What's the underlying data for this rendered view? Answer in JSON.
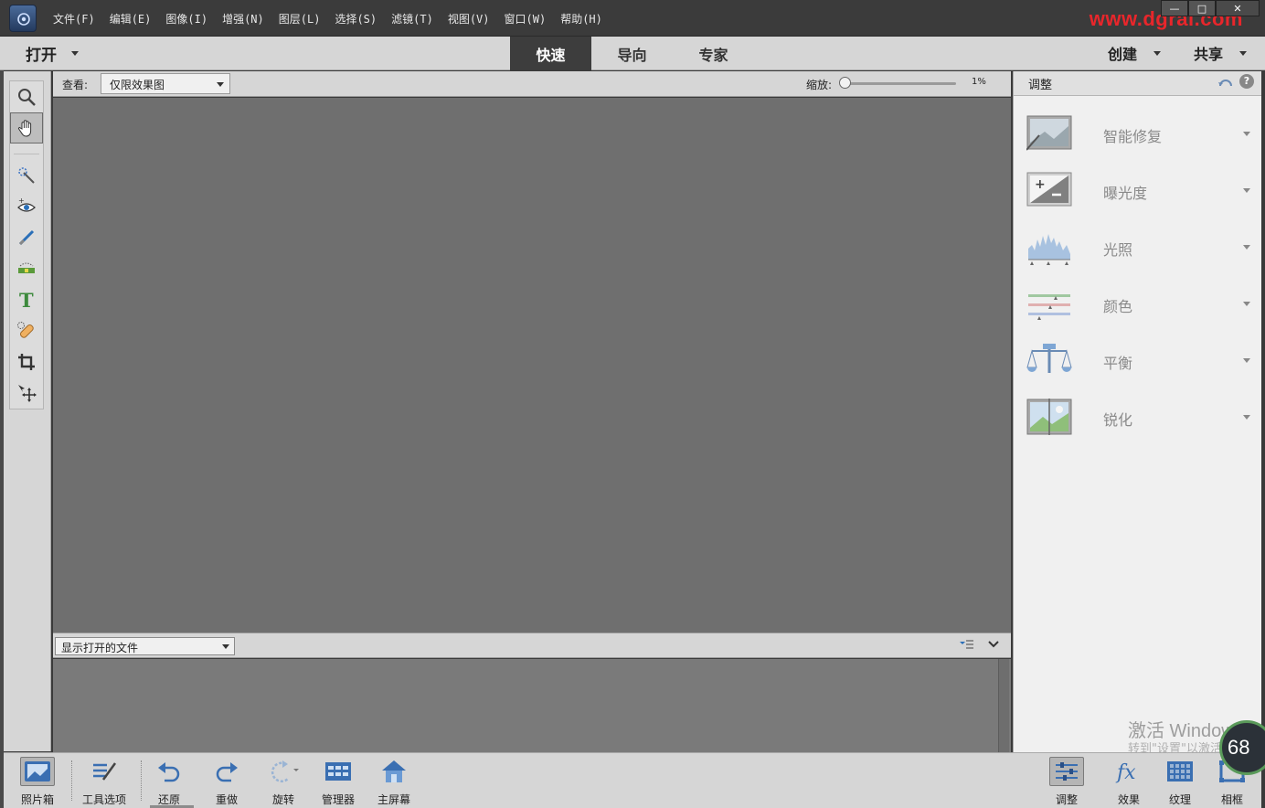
{
  "menu": {
    "items": [
      "文件(F)",
      "编辑(E)",
      "图像(I)",
      "增强(N)",
      "图层(L)",
      "选择(S)",
      "滤镜(T)",
      "视图(V)",
      "窗口(W)",
      "帮助(H)"
    ]
  },
  "window_controls": {
    "minimize": "—",
    "maximize": "□",
    "close": "✕"
  },
  "watermark_url": "www.dgrai.com",
  "modebar": {
    "open_label": "打开",
    "tabs": [
      "快速",
      "导向",
      "专家"
    ],
    "active_tab": "快速",
    "create_label": "创建",
    "share_label": "共享"
  },
  "tools": [
    "zoom-tool",
    "hand-tool",
    "quick-selection-tool",
    "red-eye-tool",
    "whiten-teeth-tool",
    "straighten-tool",
    "text-tool",
    "spot-healing-tool",
    "crop-tool",
    "move-tool"
  ],
  "view_bar": {
    "view_label": "查看:",
    "view_value": "仅限效果图",
    "zoom_label": "缩放:",
    "zoom_value": "1%",
    "zoom_fraction": 0.0
  },
  "bin": {
    "filter_value": "显示打开的文件"
  },
  "adjust_panel": {
    "title": "调整",
    "items": [
      {
        "label": "智能修复",
        "icon": "smart-fix-icon"
      },
      {
        "label": "曝光度",
        "icon": "exposure-icon"
      },
      {
        "label": "光照",
        "icon": "lighting-icon"
      },
      {
        "label": "颜色",
        "icon": "color-icon"
      },
      {
        "label": "平衡",
        "icon": "balance-icon"
      },
      {
        "label": "锐化",
        "icon": "sharpen-icon"
      }
    ]
  },
  "bottombar": {
    "photo_bin": "照片箱",
    "tool_options": "工具选项",
    "undo": "还原",
    "redo": "重做",
    "rotate": "旋转",
    "organizer": "管理器",
    "home_screen": "主屏幕",
    "adjust": "调整",
    "effects": "效果",
    "textures": "纹理",
    "frames": "相框"
  },
  "overlay": {
    "activation_title": "激活 Windows",
    "activation_sub": "转到\"设置\"以激活",
    "gauge_value": "68"
  },
  "colors": {
    "titlebar": "#3b3b3b",
    "panel_bg": "#d6d6d6",
    "canvas_bg": "#6f6f6f",
    "active_tab": "#3d3d3d",
    "watermark": "#e8262b"
  }
}
